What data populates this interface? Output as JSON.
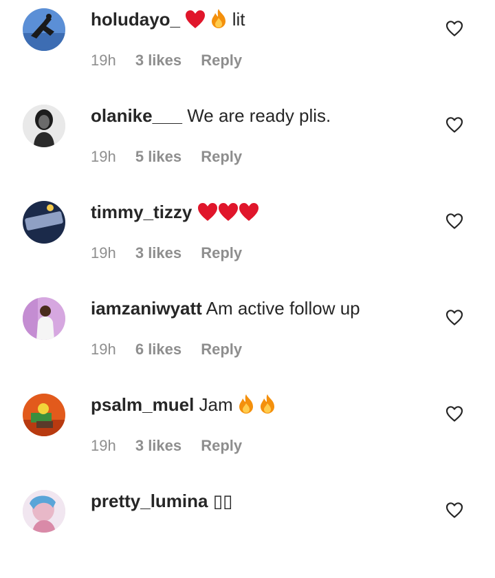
{
  "comments": [
    {
      "username": "holudayo_",
      "text": "lit",
      "emojis_before": [
        "red-heart",
        "fire"
      ],
      "time": "19h",
      "likes": "3 likes",
      "reply": "Reply"
    },
    {
      "username": "olanike___",
      "text": "We are ready plis.",
      "emojis_before": [],
      "time": "19h",
      "likes": "5 likes",
      "reply": "Reply"
    },
    {
      "username": "timmy_tizzy",
      "text": "",
      "emojis_before": [
        "red-heart",
        "red-heart",
        "red-heart"
      ],
      "time": "19h",
      "likes": "3 likes",
      "reply": "Reply"
    },
    {
      "username": "iamzaniwyatt",
      "text": "Am active follow up",
      "emojis_before": [],
      "time": "19h",
      "likes": "6 likes",
      "reply": "Reply"
    },
    {
      "username": "psalm_muel",
      "text": "Jam",
      "emojis_after": [
        "fire",
        "fire"
      ],
      "time": "19h",
      "likes": "3 likes",
      "reply": "Reply"
    },
    {
      "username": "pretty_lumina",
      "text": "▯▯",
      "time": "",
      "likes": "",
      "reply": ""
    }
  ],
  "colors": {
    "primary_text": "#262626",
    "secondary_text": "#8e8e8e",
    "heart_red": "#e0162b",
    "fire_orange": "#f4900c"
  },
  "icons": {
    "like": "heart-outline-icon",
    "emoji_heart": "red-heart-emoji",
    "emoji_fire": "fire-emoji"
  }
}
